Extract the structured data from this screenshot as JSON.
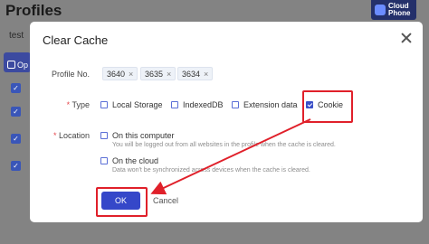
{
  "background": {
    "title": "Profiles",
    "tab_label": "test",
    "button_label": "Op",
    "logo_line1": "Cloud",
    "logo_line2": "Phone"
  },
  "dialog": {
    "title": "Clear Cache",
    "profile_label": "Profile No.",
    "profiles": [
      "3640",
      "3635",
      "3634"
    ],
    "type_label": "Type",
    "required_mark": "*",
    "types": [
      {
        "label": "Local Storage",
        "checked": false
      },
      {
        "label": "IndexedDB",
        "checked": false
      },
      {
        "label": "Extension data",
        "checked": false
      },
      {
        "label": "Cookie",
        "checked": true
      }
    ],
    "location_label": "Location",
    "locations": [
      {
        "label": "On this computer",
        "hint": "You will be logged out from all websites in the profile when the cache is cleared."
      },
      {
        "label": "On the cloud",
        "hint": "Data won't be synchronized across devices when the cache is cleared."
      }
    ],
    "ok_label": "OK",
    "cancel_label": "Cancel",
    "close_symbol": "×",
    "tag_remove_symbol": "×"
  },
  "colors": {
    "primary": "#3547c9",
    "highlight": "#e0202a",
    "required": "#e5484d"
  }
}
